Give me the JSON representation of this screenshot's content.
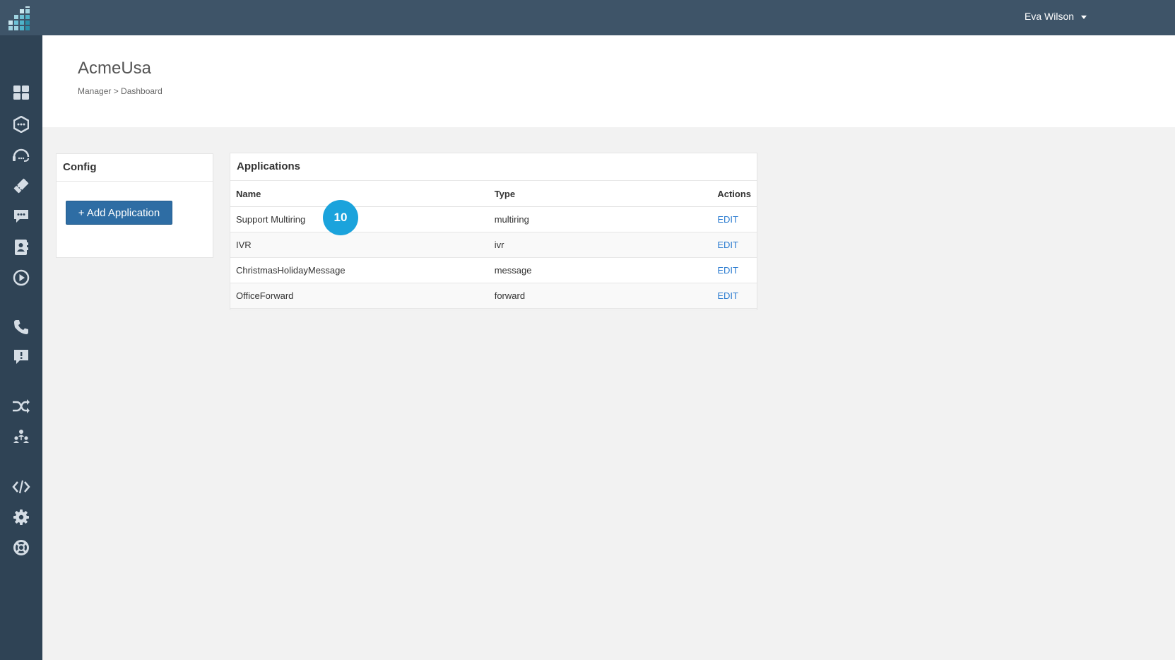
{
  "topbar": {
    "user_name": "Eva Wilson"
  },
  "sidebar": {
    "items": [
      {
        "icon": "dashboard-grid-icon"
      },
      {
        "icon": "hexagon-chat-icon"
      },
      {
        "icon": "headset-icon"
      },
      {
        "icon": "ticket-icon"
      },
      {
        "icon": "sms-bubble-icon"
      },
      {
        "icon": "contacts-book-icon"
      },
      {
        "icon": "play-circle-icon"
      },
      {
        "icon": "phone-icon"
      },
      {
        "icon": "message-alert-icon"
      },
      {
        "icon": "shuffle-icon"
      },
      {
        "icon": "team-icon"
      },
      {
        "icon": "code-icon"
      },
      {
        "icon": "gear-icon"
      },
      {
        "icon": "lifebuoy-icon"
      }
    ]
  },
  "header": {
    "title": "AcmeUsa",
    "breadcrumb": "Manager > Dashboard"
  },
  "config": {
    "title": "Config",
    "add_button_label": "+ Add Application"
  },
  "applications": {
    "title": "Applications",
    "columns": [
      "Name",
      "Type",
      "Actions"
    ],
    "rows": [
      {
        "name": "Support Multiring",
        "type": "multiring",
        "action": "EDIT"
      },
      {
        "name": "IVR",
        "type": "ivr",
        "action": "EDIT"
      },
      {
        "name": "ChristmasHolidayMessage",
        "type": "message",
        "action": "EDIT"
      },
      {
        "name": "OfficeForward",
        "type": "forward",
        "action": "EDIT"
      }
    ]
  },
  "step_badge": "10",
  "colors": {
    "topbar": "#3e5468",
    "sidebar": "#2f4355",
    "button": "#2e6da4",
    "link": "#2a7bd0",
    "badge": "#1ba3dc",
    "background": "#f2f2f2"
  }
}
